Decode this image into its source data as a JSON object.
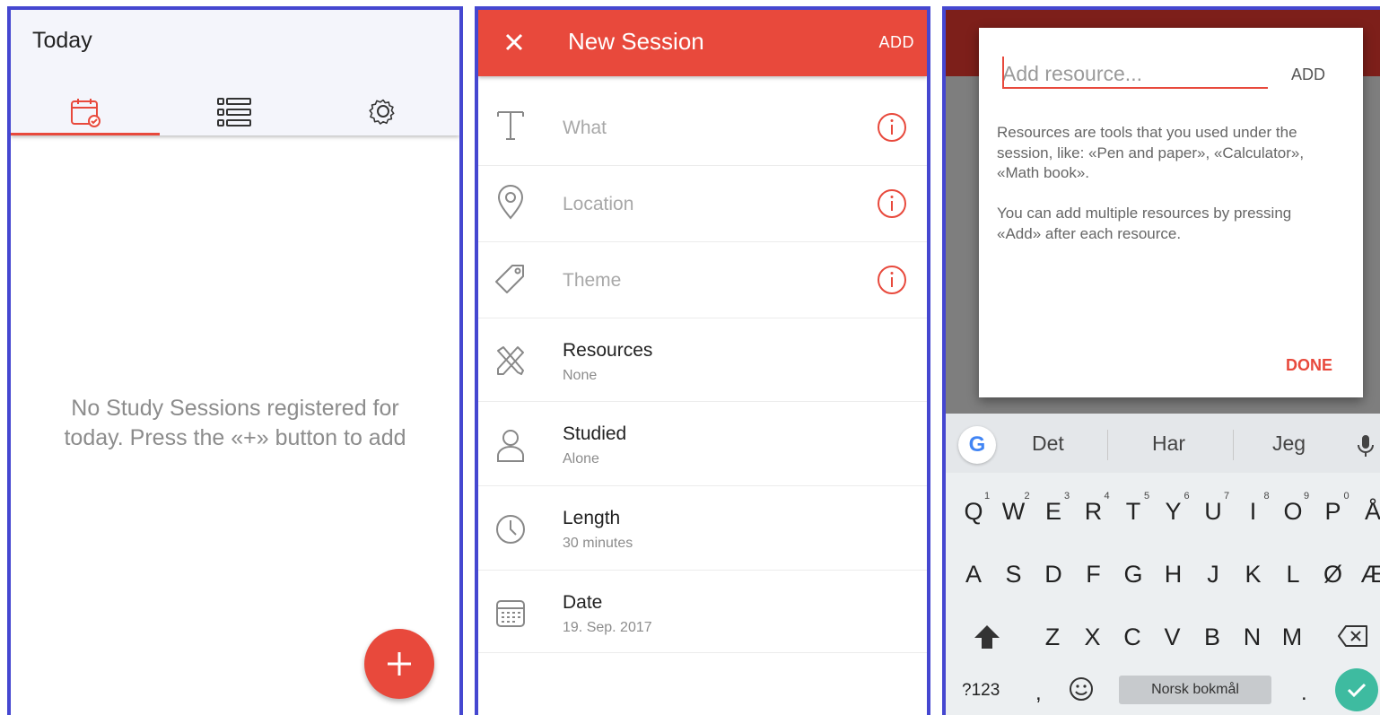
{
  "colors": {
    "accent": "#e8493c",
    "frame": "#4547d0",
    "check": "#3ebba0"
  },
  "screen1": {
    "title": "Today",
    "tabs": [
      {
        "name": "calendar-icon",
        "active": true
      },
      {
        "name": "list-icon",
        "active": false
      },
      {
        "name": "gear-icon",
        "active": false
      }
    ],
    "empty_line1": "No Study Sessions registered for",
    "empty_line2": "today. Press the «+» button to add",
    "fab_icon": "plus-icon"
  },
  "screen2": {
    "title": "New Session",
    "add_label": "ADD",
    "fields": {
      "what": {
        "placeholder": "What",
        "icon": "text-t-icon"
      },
      "location": {
        "placeholder": "Location",
        "icon": "location-pin-icon"
      },
      "theme": {
        "placeholder": "Theme",
        "icon": "tag-icon"
      },
      "resources": {
        "label": "Resources",
        "value": "None",
        "icon": "tools-icon"
      },
      "studied": {
        "label": "Studied",
        "value": "Alone",
        "icon": "person-icon"
      },
      "length": {
        "label": "Length",
        "value": "30 minutes",
        "icon": "clock-icon"
      },
      "date": {
        "label": "Date",
        "value": "19. Sep. 2017",
        "icon": "calendar-icon"
      }
    }
  },
  "screen3": {
    "dialog": {
      "input_placeholder": "Add resource...",
      "add_label": "ADD",
      "help1": [
        "Resources are tools that you used under the",
        "session, like: «Pen and paper», «Calculator»,",
        "«Math book»."
      ],
      "help2": [
        "You can add multiple resources by pressing",
        "«Add» after each resource."
      ],
      "done_label": "DONE"
    },
    "keyboard": {
      "suggestions": [
        "Det",
        "Har",
        "Jeg"
      ],
      "row1": [
        "Q",
        "W",
        "E",
        "R",
        "T",
        "Y",
        "U",
        "I",
        "O",
        "P",
        "Å"
      ],
      "row1_hints": [
        "1",
        "2",
        "3",
        "4",
        "5",
        "6",
        "7",
        "8",
        "9",
        "0"
      ],
      "row2": [
        "A",
        "S",
        "D",
        "F",
        "G",
        "H",
        "J",
        "K",
        "L",
        "Ø",
        "Æ"
      ],
      "row3": [
        "Z",
        "X",
        "C",
        "V",
        "B",
        "N",
        "M"
      ],
      "symbols": "?123",
      "comma": ",",
      "period": ".",
      "space_label": "Norsk bokmål"
    }
  }
}
